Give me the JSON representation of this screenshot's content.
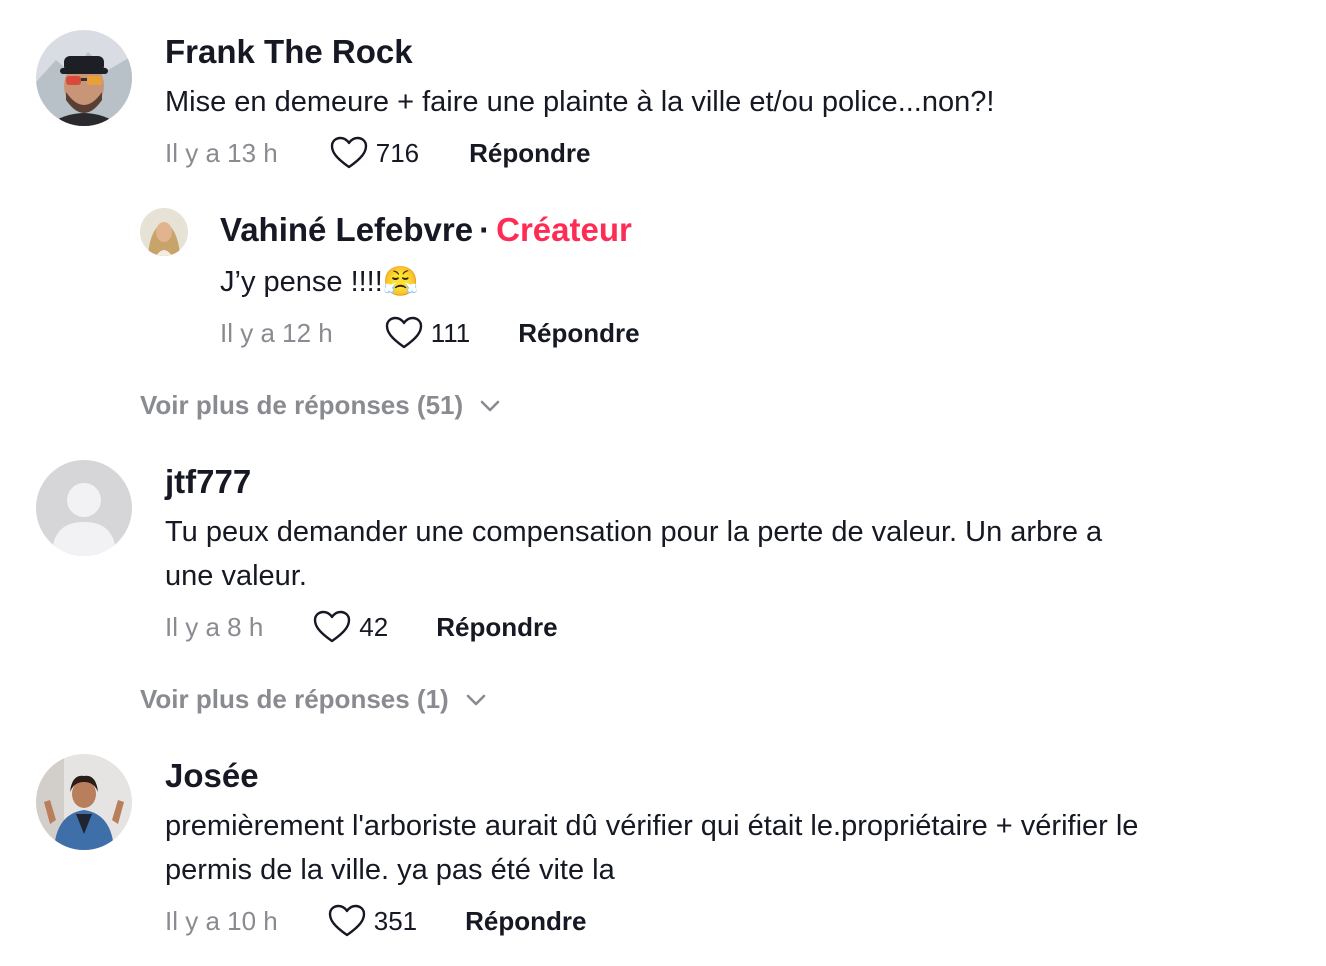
{
  "comments": [
    {
      "username": "Frank The Rock",
      "text": "Mise en demeure + faire une plainte à la ville et/ou police...non?!",
      "time": "Il y a 13 h",
      "likes": "716",
      "reply": "Répondre",
      "replies": [
        {
          "username": "Vahiné Lefebvre",
          "dot": "·",
          "creator_tag": "Créateur",
          "text": "J’y pense !!!!😤",
          "time": "Il y a 12 h",
          "likes": "111",
          "reply": "Répondre"
        }
      ],
      "more_replies": "Voir plus de réponses (51)"
    },
    {
      "username": "jtf777",
      "text_line1": "Tu peux demander une compensation pour la perte de valeur. Un arbre a",
      "text_line2": "une valeur.",
      "time": "Il y a 8 h",
      "likes": "42",
      "reply": "Répondre",
      "more_replies": "Voir plus de réponses (1)"
    },
    {
      "username": "Josée",
      "text_line1": "premièrement l'arboriste aurait dû vérifier qui était le.propriétaire + vérifier le",
      "text_line2": "permis de la ville. ya pas été vite la",
      "time": "Il y a 10 h",
      "likes": "351",
      "reply": "Répondre"
    }
  ],
  "colors": {
    "text": "#161823",
    "muted": "#8a8b91",
    "creator": "#fe2c55"
  },
  "icons": [
    "heart-outline-icon",
    "chevron-down-icon",
    "default-avatar-icon"
  ]
}
